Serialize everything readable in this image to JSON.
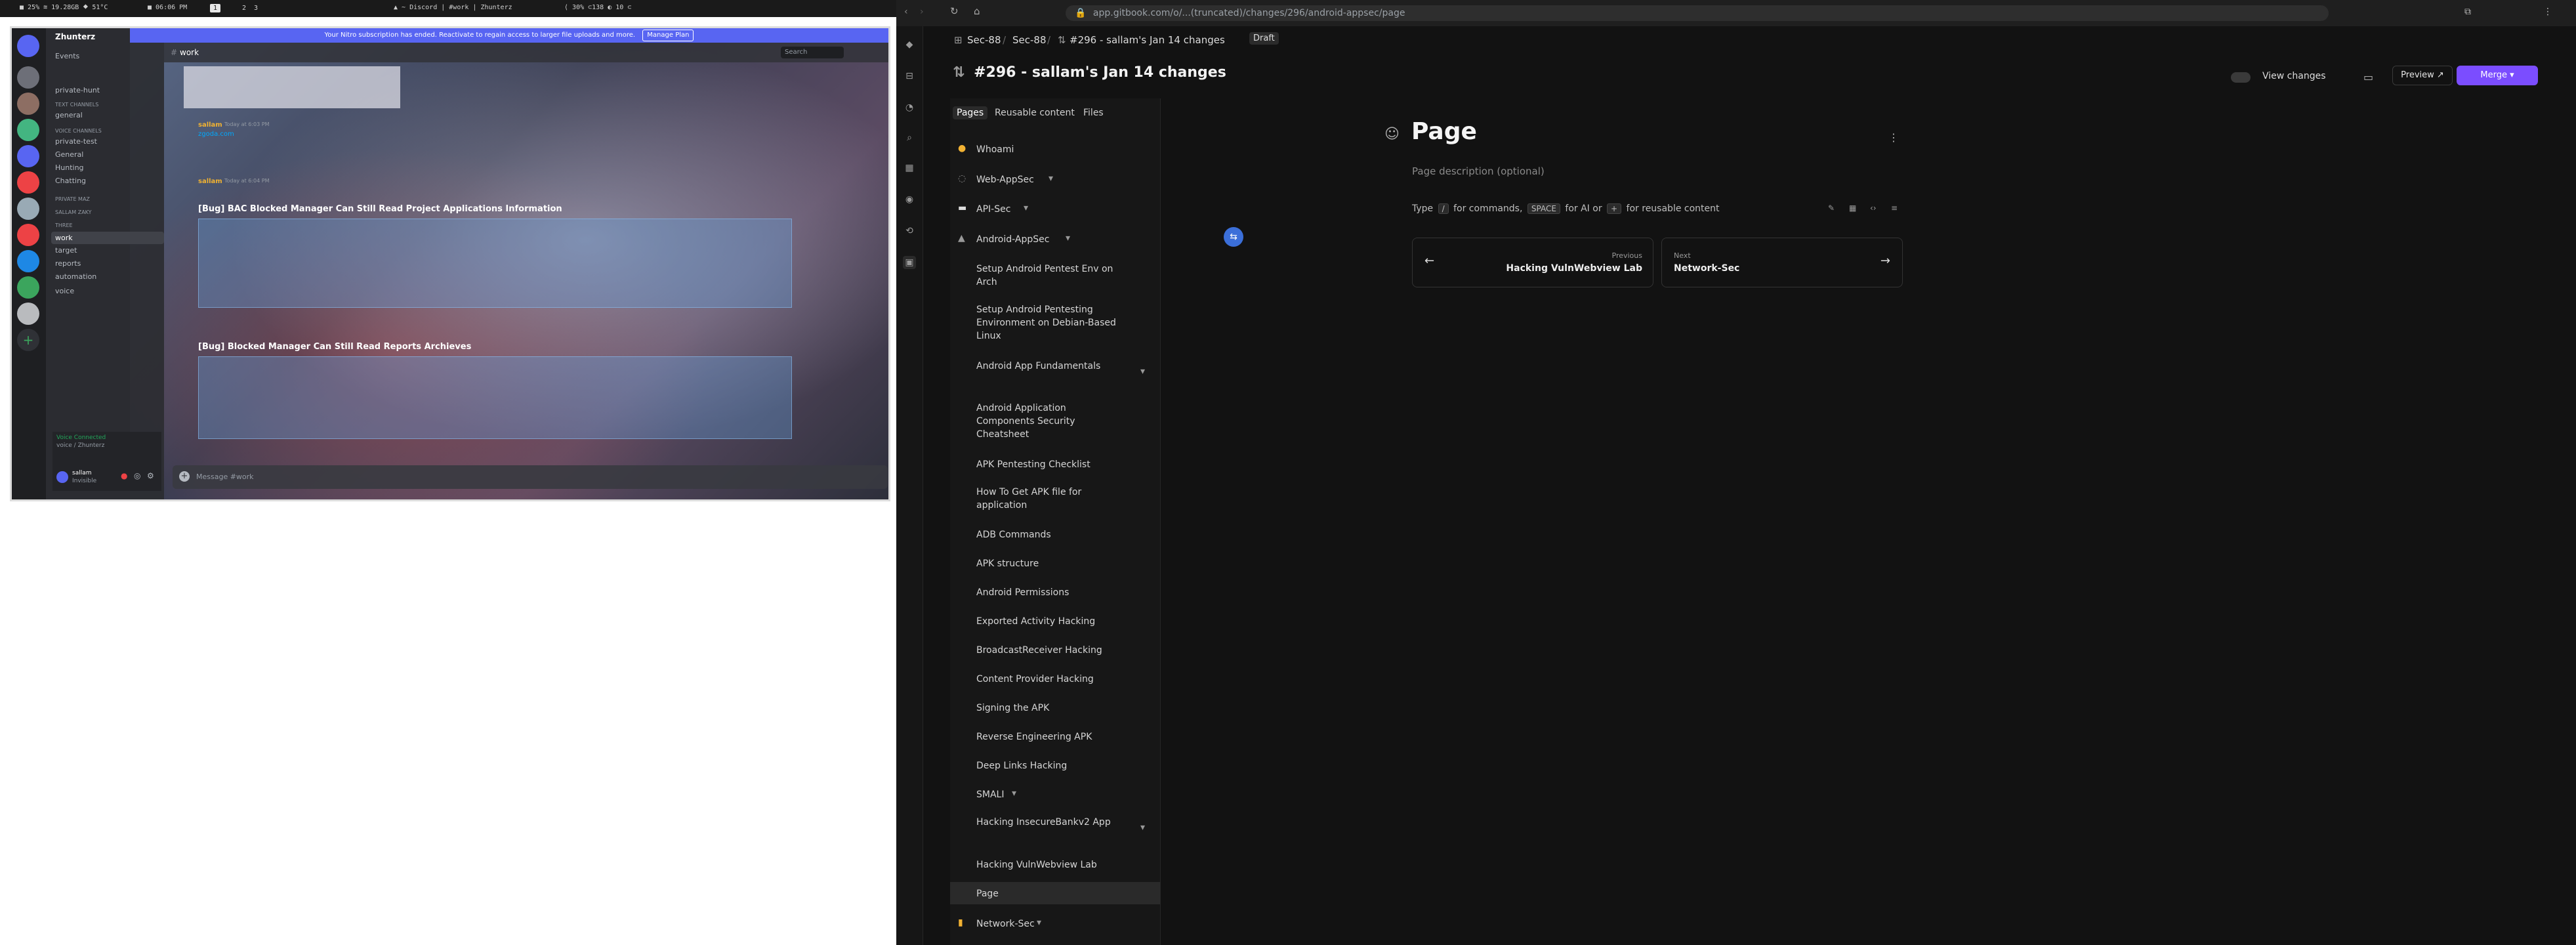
{
  "system_bar": {
    "left_status": "■ 25% ≋ 19.28GB ⯁ 51°C",
    "time": "■ 06:06 PM",
    "workspaces": [
      "1",
      "2",
      "3"
    ],
    "window_title": "▲ ~ Discord | #work | Zhunterz",
    "right_status": "⟨ 30%  ⊂138  ◐ 10  ⊂"
  },
  "discord": {
    "banner": {
      "text": "Your Nitro subscription has ended. Reactivate to regain access to larger file uploads and more.",
      "button": "Manage Plan"
    },
    "server_name": "Zhunterz",
    "channel_header": "work",
    "search_placeholder": "Search",
    "sidebar": {
      "events": "Events",
      "text_channels_cat": "Text Channels",
      "voice_channels_cat": "Voice Channels",
      "items": [
        {
          "label": "private-hunt"
        },
        {
          "label": "general"
        },
        {
          "label": "private-test"
        },
        {
          "label": "General"
        },
        {
          "label": "Hunting"
        },
        {
          "label": "Chatting"
        },
        {
          "label": "work"
        },
        {
          "label": "target"
        },
        {
          "label": "reports"
        },
        {
          "label": "automation"
        },
        {
          "label": "voice"
        }
      ],
      "private_cat": "Private MAZ",
      "sallam_cat": "Sallam Zaky",
      "three_cat": "Three"
    },
    "messages": {
      "m1_user": "sallam",
      "m1_time": "Today at 6:03 PM",
      "m1_text": "zgoda.com",
      "m2_user": "sallam",
      "m2_time": "Today at 6:04 PM",
      "title1": "[Bug] BAC Blocked Manager Can Still Read Project Applications Information",
      "title2": "[Bug] Blocked Manager Can Still Read Reports Archieves"
    },
    "input_placeholder": "Message #work",
    "voice": {
      "status": "Voice Connected",
      "channel": "voice / Zhunterz",
      "user": "sallam",
      "user_status": "Invisible"
    }
  },
  "browser": {
    "url": "app.gitbook.com/o/...(truncated)/changes/296/android-appsec/page",
    "breadcrumbs": [
      "Sec-88",
      "Sec-88",
      "#296 - sallam's Jan 14 changes"
    ],
    "draft_badge": "Draft",
    "title": "#296 - sallam's Jan 14 changes",
    "view_changes": "View changes",
    "preview": "Preview",
    "merge": "Merge",
    "tabs": [
      "Pages",
      "Reusable content",
      "Files"
    ],
    "nav": [
      {
        "label": "Whoami",
        "emoji": "●",
        "type": "top"
      },
      {
        "label": "Web-AppSec",
        "emoji": "◌",
        "type": "top"
      },
      {
        "label": "API-Sec",
        "emoji": "▬",
        "type": "top"
      },
      {
        "label": "Android-AppSec",
        "emoji": "▲",
        "type": "top"
      },
      {
        "label": "Setup Android Pentest Env on Arch",
        "type": "child"
      },
      {
        "label": "Setup Android Pentesting Environment on Debian-Based Linux",
        "type": "child"
      },
      {
        "label": "Android App Fundamentals",
        "type": "child"
      },
      {
        "label": "Android Application Components Security Cheatsheet",
        "type": "child"
      },
      {
        "label": "APK Pentesting Checklist",
        "type": "child"
      },
      {
        "label": "How To Get APK file for application",
        "type": "child"
      },
      {
        "label": "ADB Commands",
        "type": "child"
      },
      {
        "label": "APK structure",
        "type": "child"
      },
      {
        "label": "Android Permissions",
        "type": "child"
      },
      {
        "label": "Exported Activity Hacking",
        "type": "child"
      },
      {
        "label": "BroadcastReceiver Hacking",
        "type": "child"
      },
      {
        "label": "Content Provider Hacking",
        "type": "child"
      },
      {
        "label": "Signing the APK",
        "type": "child"
      },
      {
        "label": "Reverse Engineering APK",
        "type": "child"
      },
      {
        "label": "Deep Links Hacking",
        "type": "child"
      },
      {
        "label": "SMALI",
        "type": "child"
      },
      {
        "label": "Hacking InsecureBankv2 App",
        "type": "child"
      },
      {
        "label": "Hacking VulnWebview Lab",
        "type": "child"
      },
      {
        "label": "Page",
        "type": "child",
        "selected": true
      },
      {
        "label": "Network-Sec",
        "emoji": "▮",
        "type": "top"
      }
    ],
    "page": {
      "title": "Page",
      "description_placeholder": "Page description (optional)",
      "hint_type": "Type",
      "hint_slash": "/",
      "hint_commands": "for commands,",
      "hint_space": "SPACE",
      "hint_ai": "for AI or",
      "hint_plus": "+",
      "hint_reusable": "for reusable content",
      "prev_label": "Previous",
      "prev_title": "Hacking VulnWebview Lab",
      "next_label": "Next",
      "next_title": "Network-Sec"
    },
    "colors": {
      "accent": "#7b4dff",
      "bg": "#121212",
      "sidebar": "#171717"
    }
  }
}
